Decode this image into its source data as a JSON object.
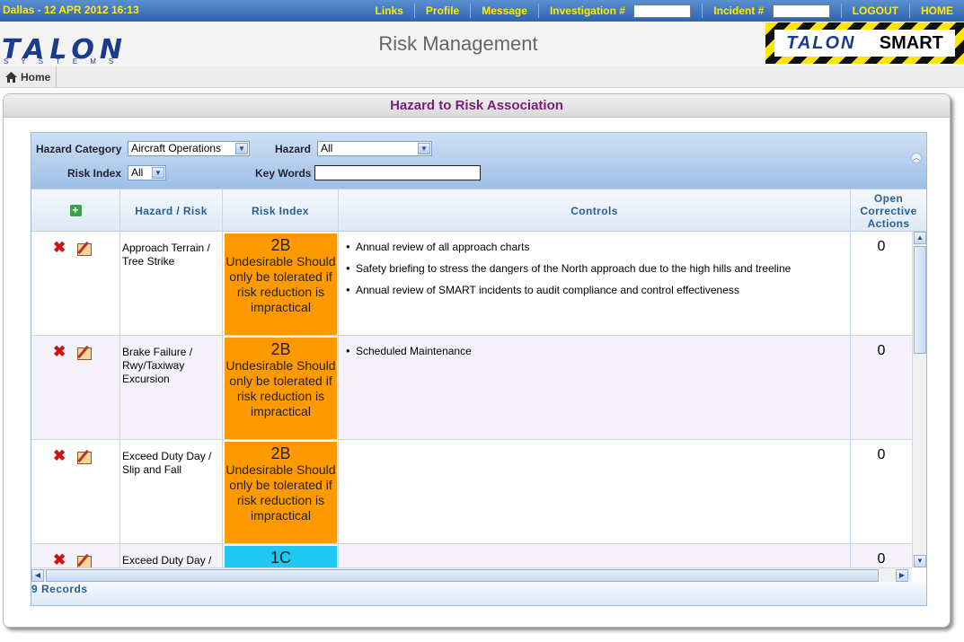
{
  "topbar": {
    "datetime": "Dallas - 12 APR 2012 16:13",
    "links": [
      "Links",
      "Profile",
      "Message"
    ],
    "investigation_label": "Investigation #",
    "investigation_value": "",
    "incident_label": "Incident #",
    "incident_value": "",
    "logout": "LOGOUT",
    "home": "HOME"
  },
  "header": {
    "logo_word": "TALON",
    "logo_sub": "SYSTEMS",
    "title": "Risk Management",
    "badge_left": "TALON",
    "badge_right": "SMART"
  },
  "breadcrumb": {
    "home": "Home"
  },
  "panel": {
    "title": "Hazard to Risk Association"
  },
  "filters": {
    "hazard_category_label": "Hazard Category",
    "hazard_category_value": "Aircraft Operations",
    "hazard_label": "Hazard",
    "hazard_value": "All",
    "risk_index_label": "Risk Index",
    "risk_index_value": "All",
    "keywords_label": "Key Words",
    "keywords_value": ""
  },
  "columns": {
    "hazard_risk": "Hazard / Risk",
    "risk_index": "Risk Index",
    "controls": "Controls",
    "oca": "Open Corrective Actions"
  },
  "rows": [
    {
      "hazard": "Approach Terrain / Tree Strike",
      "risk_code": "2B",
      "risk_desc": "Undesirable Should only be tolerated if risk reduction is impractical",
      "risk_color": "#ff9900",
      "controls": [
        "Annual review of all approach charts",
        "Safety briefing to stress the dangers of the North approach due to the high hills and treeline",
        "Annual review of SMART incidents to audit compliance and control effectiveness"
      ],
      "oca": "0"
    },
    {
      "hazard": "Brake Failure / Rwy/Taxiway Excursion",
      "risk_code": "2B",
      "risk_desc": "Undesirable Should only be tolerated if risk reduction is impractical",
      "risk_color": "#ff9900",
      "controls": [
        "Scheduled Maintenance"
      ],
      "oca": "0"
    },
    {
      "hazard": "Exceed Duty Day / Slip and Fall",
      "risk_code": "2B",
      "risk_desc": "Undesirable Should only be tolerated if risk reduction is impractical",
      "risk_color": "#ff9900",
      "controls": [],
      "oca": "0"
    },
    {
      "hazard": "Exceed Duty Day /",
      "risk_code": "1C",
      "risk_desc": "",
      "risk_color": "#1ec8f0",
      "controls": [],
      "oca": "0"
    }
  ],
  "footer": {
    "records": "9 Records"
  },
  "colors": {
    "accent_yellow": "#ffea00",
    "title_purple": "#7a1d7a",
    "header_blue": "#2b5f95"
  }
}
